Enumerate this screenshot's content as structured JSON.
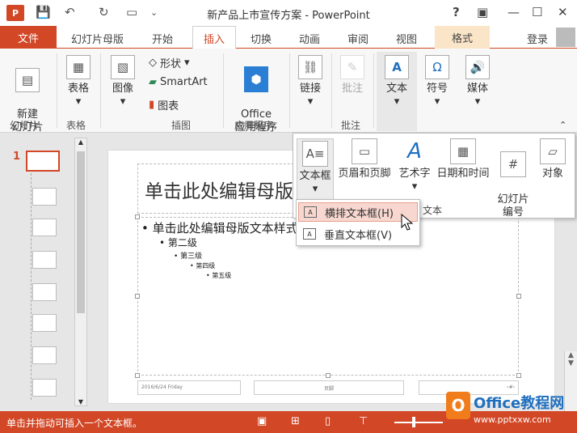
{
  "window": {
    "title": "新产品上市宣传方案 - PowerPoint",
    "app_logo": "P",
    "quick_access": [
      "save-icon",
      "undo-icon",
      "redo-icon",
      "slideshow-icon"
    ],
    "help": "?",
    "controls": [
      "ribbon-display-icon",
      "minimize-icon",
      "maximize-icon",
      "close-icon"
    ]
  },
  "tabs": {
    "file": "文件",
    "items": [
      "幻灯片母版",
      "开始",
      "插入",
      "切换",
      "动画",
      "审阅",
      "视图",
      "格式"
    ],
    "active": "插入",
    "login": "登录"
  },
  "ribbon": {
    "new_slide": "新建\n幻灯片",
    "group_slides": "幻灯片",
    "table": "表格",
    "group_table": "表格",
    "image": "图像",
    "shapes": "形状",
    "smartart": "SmartArt",
    "chart": "图表",
    "group_illustrations": "插图",
    "office_apps": "Office\n应用程序",
    "group_apps": "应用程序",
    "link": "链接",
    "comment": "批注",
    "group_comments": "批注",
    "text": "文本",
    "symbol": "符号",
    "media": "媒体"
  },
  "gallery": {
    "items": [
      "文本框",
      "页眉和页脚",
      "艺术字",
      "日期和时间",
      "幻灯片\n编号",
      "对象"
    ],
    "group_label": "文本"
  },
  "textbox_menu": {
    "items": [
      "横排文本框(H)",
      "垂直文本框(V)"
    ]
  },
  "slide_pane": {
    "selected_number": "1"
  },
  "slide": {
    "title_placeholder": "单击此处编辑母版",
    "level1": "• 单击此处编辑母版文本样式",
    "level2": "• 第二级",
    "level3": "• 第三级",
    "level4": "• 第四级",
    "level5": "• 第五级",
    "footer_date": "2016/6/24 Friday",
    "footer_center": "页脚",
    "footer_right": "‹#›"
  },
  "status": {
    "message": "单击并拖动可插入一个文本框。"
  },
  "watermark": {
    "logo": "O",
    "name": "Office教程网",
    "url": "www.pptxxw.com"
  },
  "colors": {
    "accent": "#d24726",
    "contextual_tab": "#fbe5c8"
  }
}
